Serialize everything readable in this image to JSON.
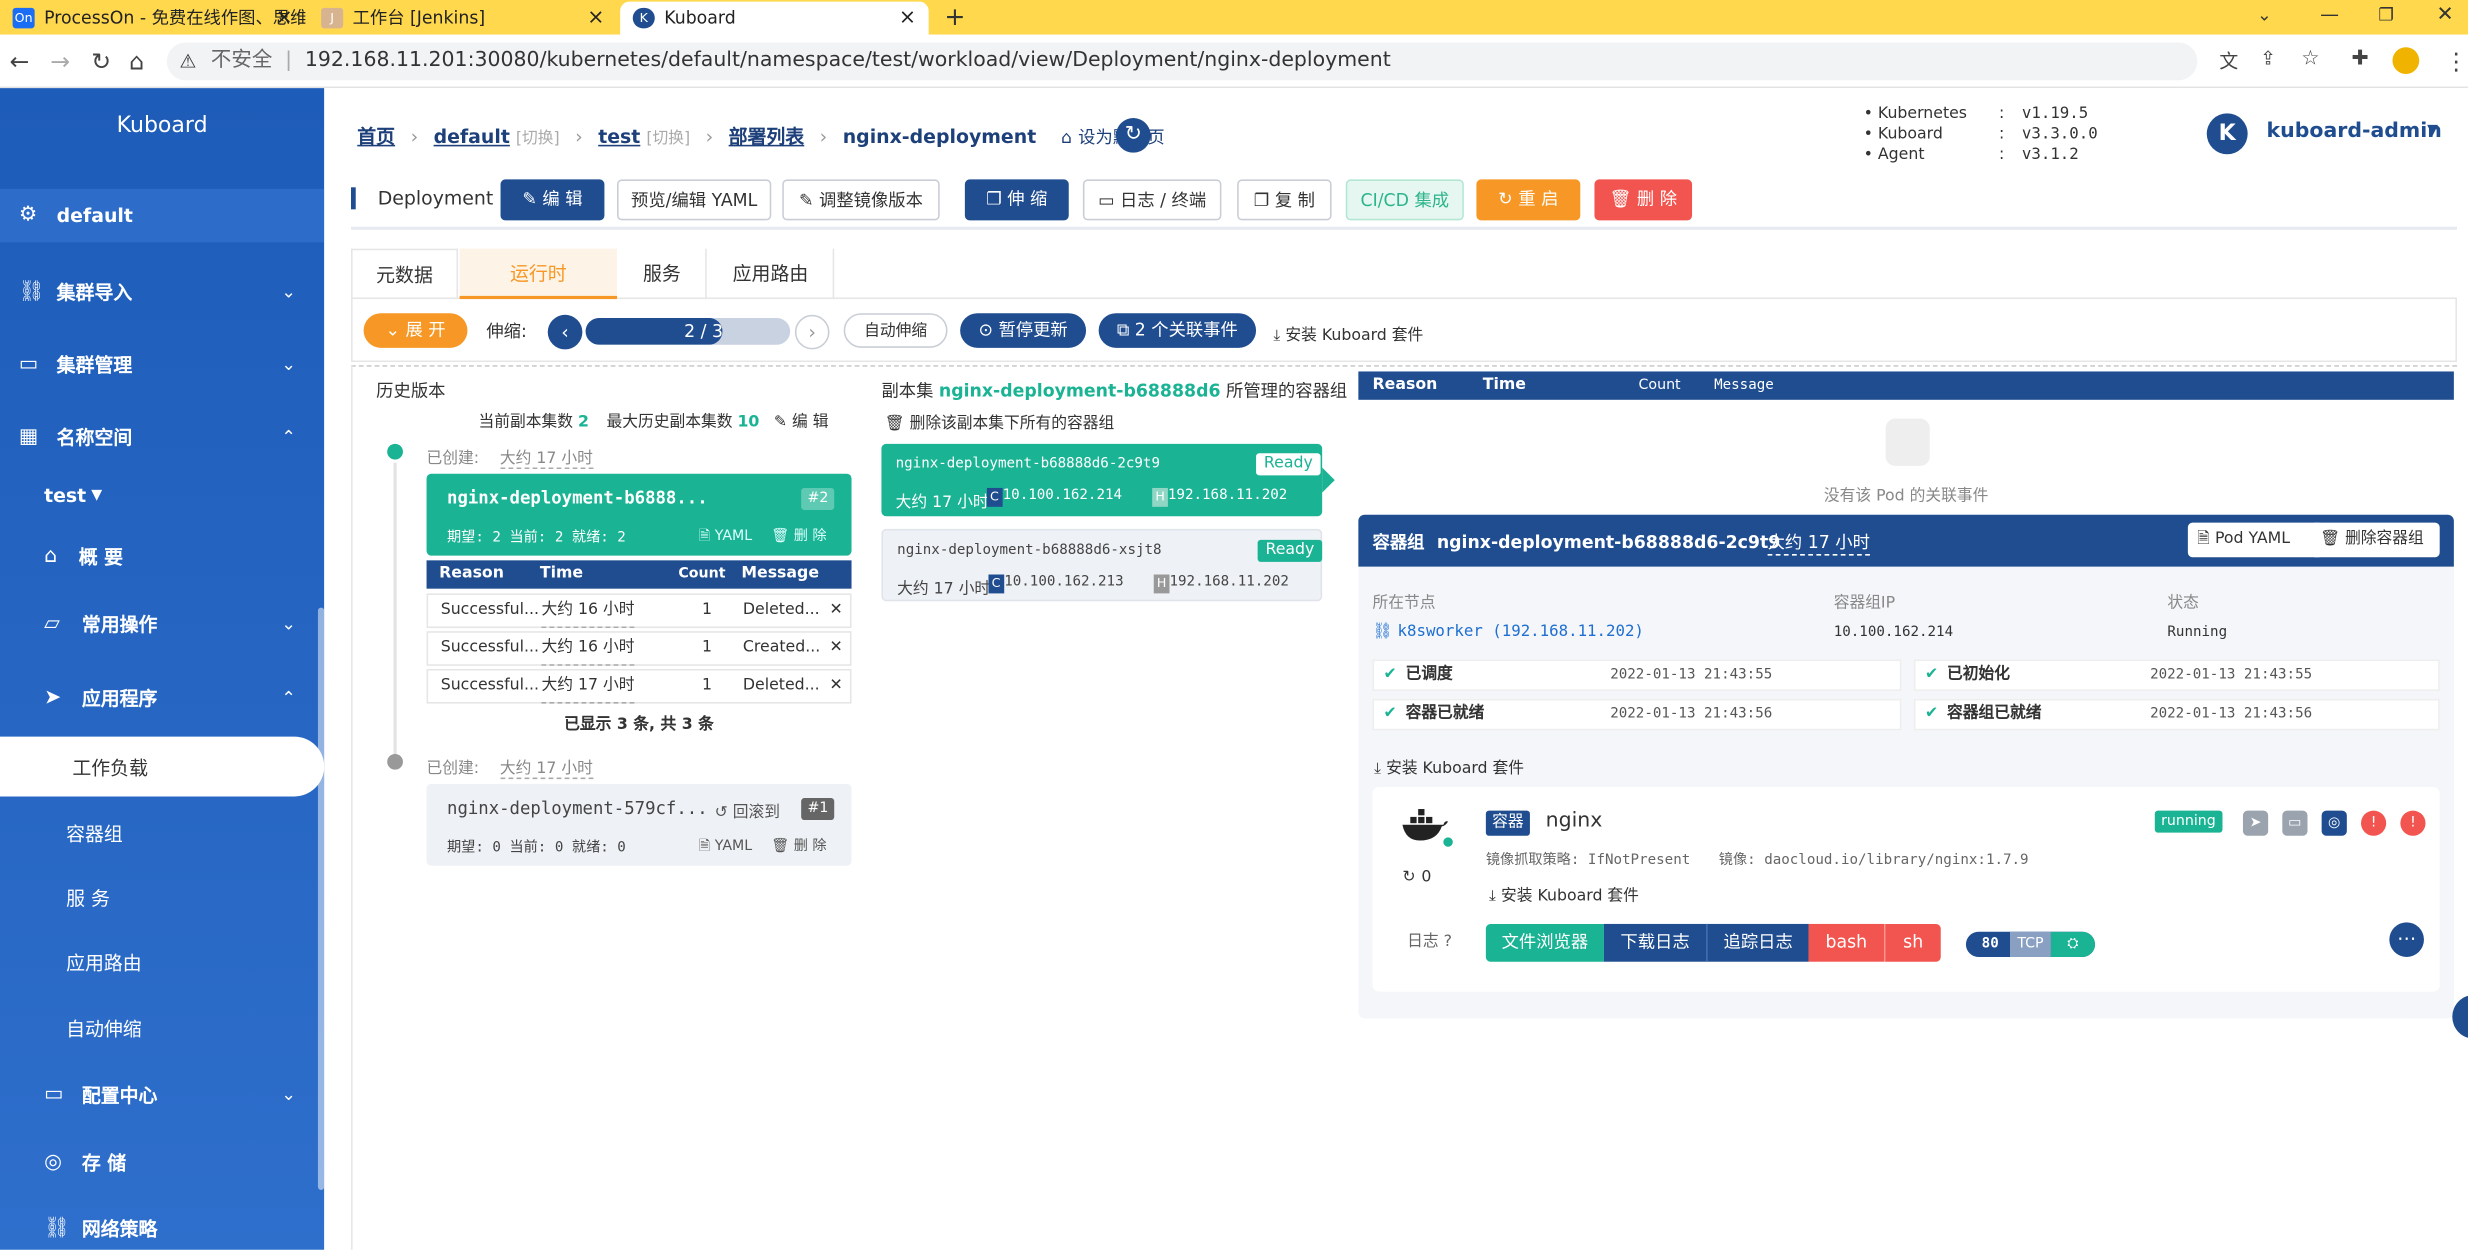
{
  "browser": {
    "tabs": [
      {
        "label": "ProcessOn - 免费在线作图、思维...",
        "icon": "On"
      },
      {
        "label": "工作台 [Jenkins]",
        "icon": "J"
      },
      {
        "label": "Kuboard",
        "icon": "K"
      }
    ],
    "insecure": "不安全",
    "url": "192.168.11.201:30080/kubernetes/default/namespace/test/workload/view/Deployment/nginx-deployment"
  },
  "sidebar": {
    "brand": "Kuboard",
    "cluster": "default",
    "items": [
      {
        "label": "集群导入",
        "icon": "link-icon",
        "expanded": false
      },
      {
        "label": "集群管理",
        "icon": "briefcase-icon",
        "expanded": false
      },
      {
        "label": "名称空间",
        "icon": "grid-icon",
        "expanded": true
      }
    ],
    "namespace": "test",
    "ns_items": [
      {
        "label": "概 要",
        "icon": "home-icon"
      },
      {
        "label": "常用操作",
        "icon": "folder-icon",
        "expanded": false
      },
      {
        "label": "应用程序",
        "icon": "send-icon",
        "expanded": true
      }
    ],
    "app_sub": [
      "工作负载",
      "容器组",
      "服 务",
      "应用路由",
      "自动伸缩"
    ],
    "bottom_items": [
      {
        "label": "配置中心",
        "icon": "briefcase-icon"
      },
      {
        "label": "存 储",
        "icon": "database-icon"
      },
      {
        "label": "网络策略",
        "icon": "link-icon"
      }
    ]
  },
  "breadcrumb": {
    "home": "首页",
    "cluster": "default",
    "switch": "[切换]",
    "namespace": "test",
    "list": "部署列表",
    "current": "nginx-deployment",
    "set_default": "设为默认页"
  },
  "versions": {
    "rows": [
      {
        "name": "Kubernetes",
        "value": "v1.19.5"
      },
      {
        "name": "Kuboard",
        "value": "v3.3.0.0"
      },
      {
        "name": "Agent",
        "value": "v3.1.2"
      }
    ]
  },
  "user": {
    "initial": "K",
    "name": "kuboard-admin"
  },
  "toolbar": {
    "kind": "Deployment",
    "edit": "编 辑",
    "preview_yaml": "预览/编辑 YAML",
    "adjust_image": "调整镜像版本",
    "scale": "伸 缩",
    "logs": "日志 / 终端",
    "copy": "复 制",
    "cicd": "CI/CD 集成",
    "restart": "重 启",
    "delete": "删 除"
  },
  "tabs": [
    "元数据",
    "运行时",
    "服务",
    "应用路由"
  ],
  "active_tab": 1,
  "scale_bar": {
    "expand": "展 开",
    "label": "伸缩:",
    "progress_text": "2 / 3",
    "progress": 0.67,
    "auto_scale": "自动伸缩",
    "pause": "暂停更新",
    "events": "2 个关联事件",
    "install": "安装 Kuboard 套件"
  },
  "history": {
    "title": "历史版本",
    "current_label": "当前副本集数",
    "current_value": "2",
    "max_label": "最大历史副本集数",
    "max_value": "10",
    "edit": "编 辑",
    "created_label": "已创建:",
    "revisions": [
      {
        "created": "大约 17 小时",
        "name": "nginx-deployment-b6888...",
        "rev": "#2",
        "status": "期望: 2 当前: 2 就绪: 2",
        "yaml": "YAML",
        "delete": "删 除",
        "events_header": [
          "Reason",
          "Time",
          "Count",
          "Message"
        ],
        "events": [
          {
            "reason": "Successful...",
            "time": "大约 16 小时",
            "count": "1",
            "message": "Deleted..."
          },
          {
            "reason": "Successful...",
            "time": "大约 16 小时",
            "count": "1",
            "message": "Created..."
          },
          {
            "reason": "Successful...",
            "time": "大约 17 小时",
            "count": "1",
            "message": "Deleted..."
          }
        ],
        "footer": "已显示 3 条, 共 3 条"
      },
      {
        "created": "大约 17 小时",
        "name": "nginx-deployment-579cf...",
        "rev": "#1",
        "rollback": "回滚到",
        "status": "期望: 0 当前: 0 就绪: 0",
        "yaml": "YAML",
        "delete": "删 除"
      }
    ]
  },
  "replicaset": {
    "prefix": "副本集",
    "name": "nginx-deployment-b68888d6",
    "suffix": "所管理的容器组",
    "delete_all": "删除该副本集下所有的容器组",
    "pods": [
      {
        "name": "nginx-deployment-b68888d6-2c9t9",
        "status": "Ready",
        "age": "大约 17 小时",
        "cip": "10.100.162.214",
        "hip": "192.168.11.202"
      },
      {
        "name": "nginx-deployment-b68888d6-xsjt8",
        "status": "Ready",
        "age": "大约 17 小时",
        "cip": "10.100.162.213",
        "hip": "192.168.11.202"
      }
    ]
  },
  "pod_events": {
    "header": [
      "Reason",
      "Time",
      "Count",
      "Message"
    ],
    "empty": "没有该 Pod 的关联事件"
  },
  "pod_detail": {
    "title_prefix": "容器组",
    "name": "nginx-deployment-b68888d6-2c9t9",
    "age": "大约 17 小时",
    "yaml_btn": "Pod YAML",
    "delete_btn": "删除容器组",
    "node_label": "所在节点",
    "node_value": "k8sworker (192.168.11.202)",
    "ip_label": "容器组IP",
    "ip_value": "10.100.162.214",
    "status_label": "状态",
    "status_value": "Running",
    "conditions": [
      {
        "label": "已调度",
        "time": "2022-01-13 21:43:55"
      },
      {
        "label": "已初始化",
        "time": "2022-01-13 21:43:55"
      },
      {
        "label": "容器已就绪",
        "time": "2022-01-13 21:43:56"
      },
      {
        "label": "容器组已就绪",
        "time": "2022-01-13 21:43:56"
      }
    ],
    "install": "安装 Kuboard 套件",
    "container": {
      "tag": "容器",
      "name": "nginx",
      "state": "running",
      "restarts": "0",
      "pull_policy": "镜像抓取策略: IfNotPresent",
      "image": "镜像: daocloud.io/library/nginx:1.7.9",
      "install": "安装 Kuboard 套件",
      "log_label": "日志",
      "actions": [
        "文件浏览器",
        "下载日志",
        "追踪日志",
        "bash",
        "sh"
      ],
      "port": "80",
      "proto": "TCP"
    }
  },
  "colors": {
    "brand_blue": "#1f4d8f",
    "green": "#1ab394",
    "orange": "#f79826",
    "red": "#f2554f",
    "chrome_tab_bar": "#ffd84d"
  }
}
